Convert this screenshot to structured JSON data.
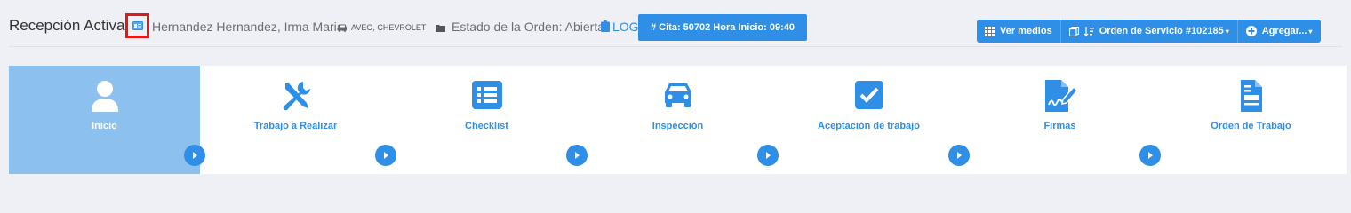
{
  "header": {
    "title": "Recepción Activa",
    "customer": "Hernandez Hernandez, Irma Maria",
    "vehicle": "AVEO, CHEVROLET",
    "order_status": "Estado de la Orden: Abierta",
    "log_link": "LOG",
    "cita_button": "# Cita: 50702 Hora Inicio: 09:40"
  },
  "toolbar": {
    "ver_medios": "Ver medios",
    "orden_servicio": "Orden de Servicio #102185",
    "agregar": "Agregar..."
  },
  "steps": [
    {
      "label": "Inicio",
      "icon": "user-icon",
      "active": true
    },
    {
      "label": "Trabajo a Realizar",
      "icon": "tools-icon",
      "active": false
    },
    {
      "label": "Checklist",
      "icon": "list-icon",
      "active": false
    },
    {
      "label": "Inspección",
      "icon": "car-icon",
      "active": false
    },
    {
      "label": "Aceptación de trabajo",
      "icon": "checkbox-icon",
      "active": false
    },
    {
      "label": "Firmas",
      "icon": "signature-icon",
      "active": false
    },
    {
      "label": "Orden de Trabajo",
      "icon": "document-icon",
      "active": false
    }
  ],
  "colors": {
    "accent": "#2f8ee5",
    "active_step": "#8cc1ef",
    "highlight_border": "#e01818"
  }
}
